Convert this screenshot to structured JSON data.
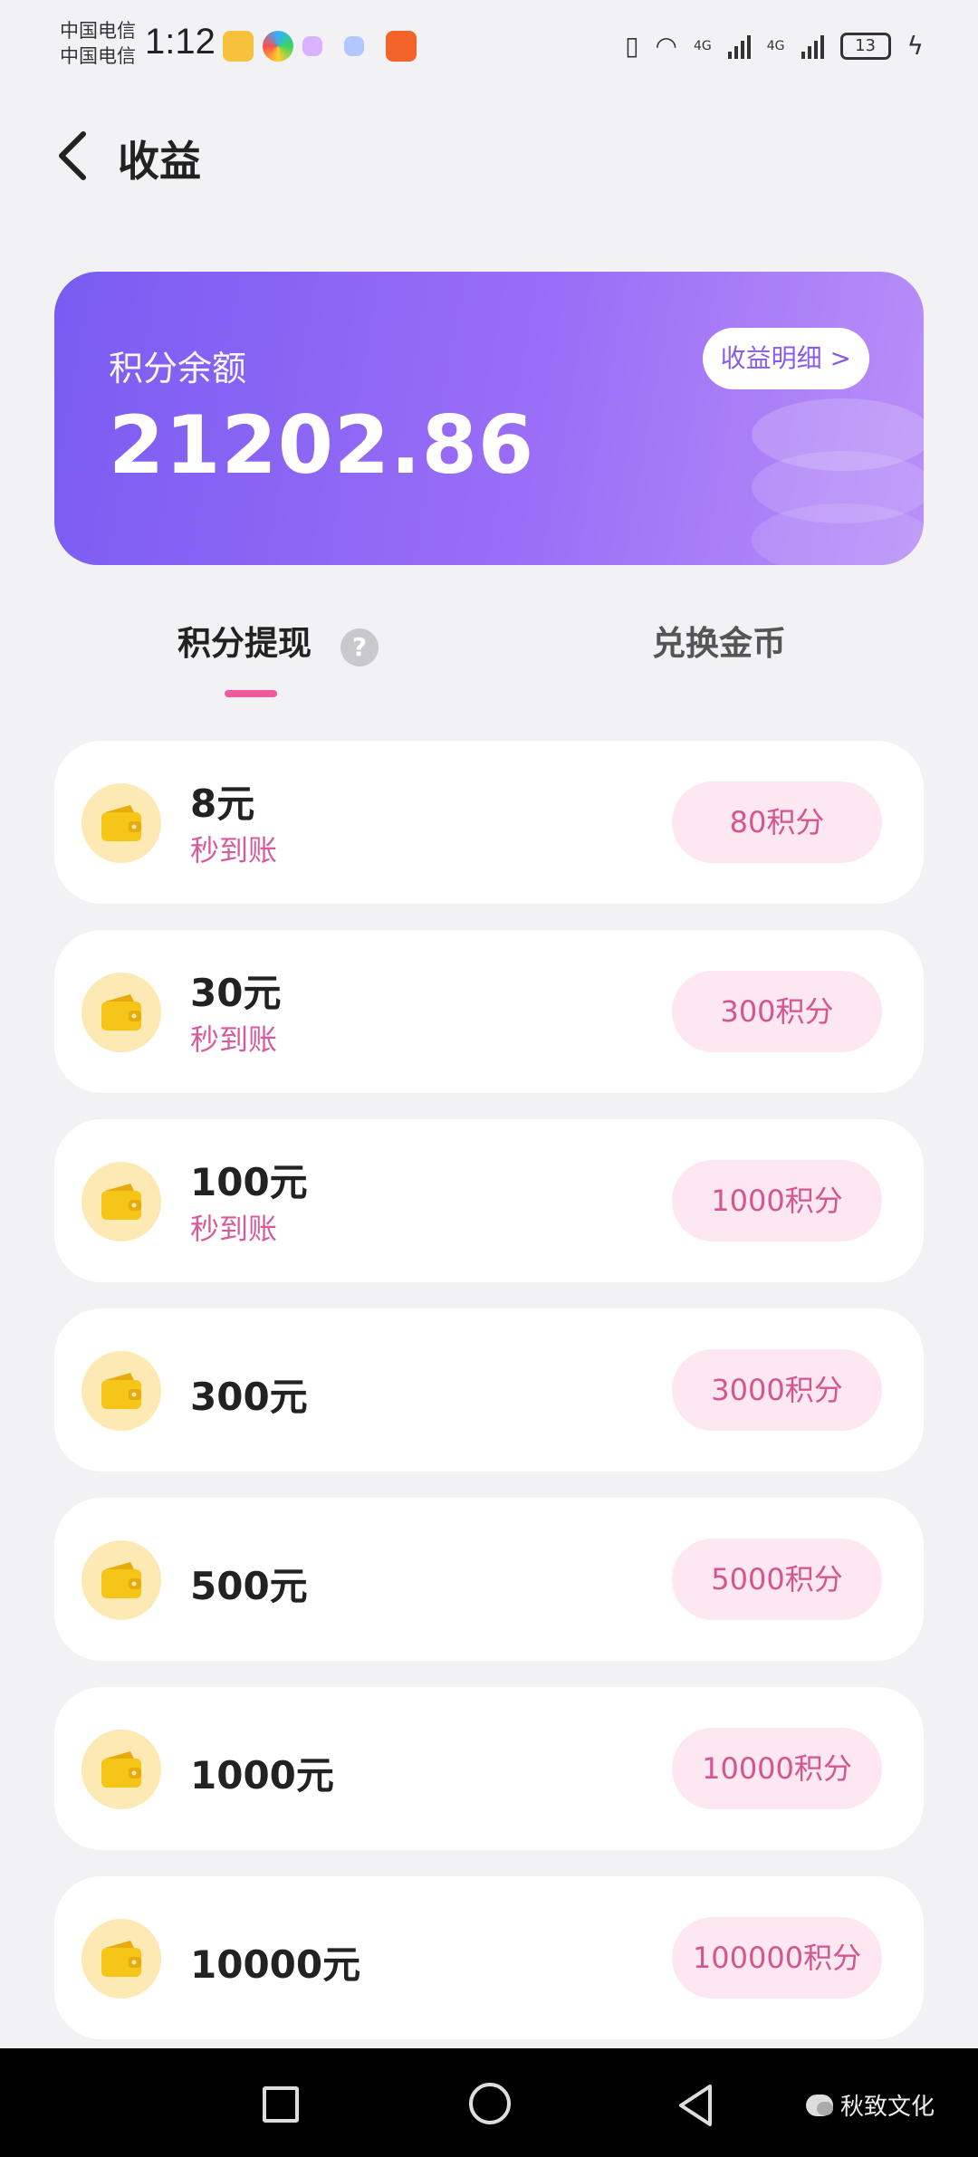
{
  "status_bar": {
    "carrier_1": "中国电信",
    "carrier_2": "中国电信",
    "time": "1:12",
    "network_1": "4G",
    "network_2": "4G",
    "battery": "13"
  },
  "header": {
    "back_icon": "chevron-left-icon",
    "title": "收益"
  },
  "balance_card": {
    "label": "积分余额",
    "value": "21202.86",
    "detail_button": "收益明细 >"
  },
  "tabs": [
    {
      "label": "积分提现",
      "active": true
    },
    {
      "label": "兑换金币",
      "active": false
    }
  ],
  "help_icon": "?",
  "options": [
    {
      "amount": "8元",
      "sub": "秒到账",
      "points": "80积分"
    },
    {
      "amount": "30元",
      "sub": "秒到账",
      "points": "300积分"
    },
    {
      "amount": "100元",
      "sub": "秒到账",
      "points": "1000积分"
    },
    {
      "amount": "300元",
      "sub": "",
      "points": "3000积分"
    },
    {
      "amount": "500元",
      "sub": "",
      "points": "5000积分"
    },
    {
      "amount": "1000元",
      "sub": "",
      "points": "10000积分"
    },
    {
      "amount": "10000元",
      "sub": "",
      "points": "100000积分"
    }
  ],
  "watermark": "秋致文化",
  "colors": {
    "accent": "#ef5a9a",
    "card_gradient_start": "#7a5cf2",
    "card_gradient_end": "#b98ff8",
    "points_pill": "#fde8f1",
    "wallet_yellow": "#f5c518"
  }
}
